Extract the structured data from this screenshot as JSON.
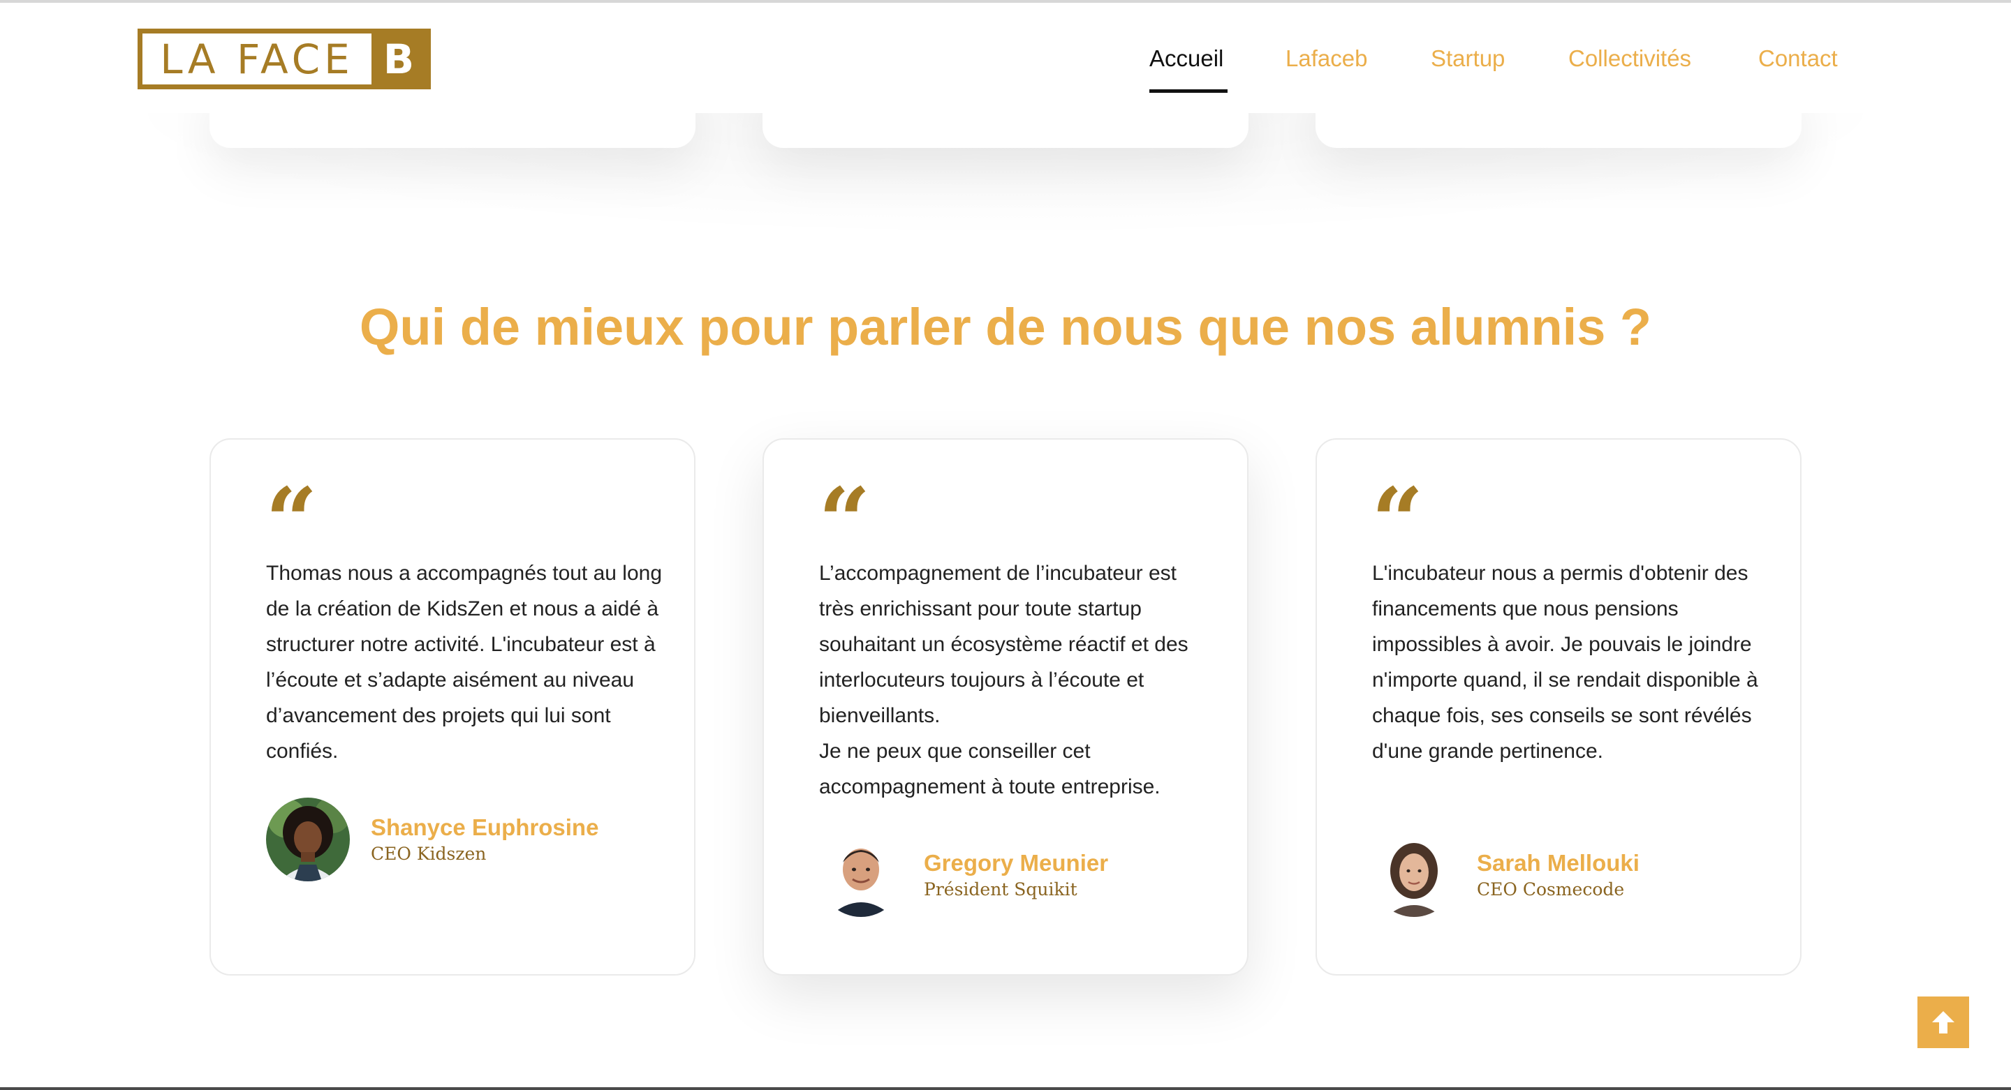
{
  "brand": {
    "logo_main": "LA FACE",
    "logo_letter": "B",
    "accent_color": "#ebae4a",
    "brand_color": "#a67c25"
  },
  "nav": {
    "items": [
      {
        "label": "Accueil",
        "active": true
      },
      {
        "label": "Lafaceb",
        "active": false
      },
      {
        "label": "Startup",
        "active": false
      },
      {
        "label": "Collectivités",
        "active": false
      },
      {
        "label": "Contact",
        "active": false
      }
    ]
  },
  "section": {
    "title": "Qui de mieux pour parler de nous que nos alumnis ?"
  },
  "testimonials": [
    {
      "quote_icon": "quote-icon",
      "paragraphs": [
        "Thomas nous a accompagnés tout au long de la création de KidsZen et nous a aidé à structurer notre activité. L'incubateur est à l’écoute et s’adapte aisément au niveau d’avancement des projets qui lui sont confiés."
      ],
      "name": "Shanyce Euphrosine",
      "role": "CEO Kidszen"
    },
    {
      "quote_icon": "quote-icon",
      "paragraphs": [
        "L’accompagnement de l’incubateur est très enrichissant pour toute startup souhaitant un écosystème réactif et des interlocuteurs toujours à l’écoute et bienveillants.",
        "Je ne peux que conseiller cet accompagnement à toute entreprise."
      ],
      "name": "Gregory Meunier",
      "role": "Président Squikit"
    },
    {
      "quote_icon": "quote-icon",
      "paragraphs": [
        "L'incubateur nous a permis d'obtenir des financements que nous pensions impossibles à avoir. Je pouvais le joindre n'importe quand, il se rendait disponible à chaque fois, ses conseils se sont révélés d'une grande pertinence."
      ],
      "name": "Sarah Mellouki",
      "role": "CEO Cosmecode"
    }
  ],
  "scroll_top_icon": "arrow-up-icon"
}
